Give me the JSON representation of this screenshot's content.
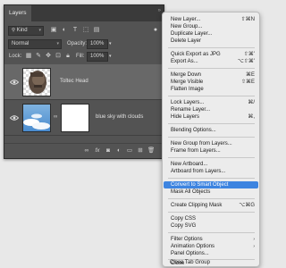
{
  "panel": {
    "tab_label": "Layers",
    "menu_glyph": "≡",
    "filter": {
      "value": "Kind",
      "icon": "search-icon"
    },
    "blend_mode": "Normal",
    "opacity_label": "Opacity:",
    "opacity_value": "100%",
    "lock_label": "Lock:",
    "fill_label": "Fill:",
    "fill_value": "100%",
    "layers": [
      {
        "name": "Toltec Head",
        "visible": true,
        "selected": true,
        "thumbnail": "stone-head"
      },
      {
        "name": "blue sky with clouds",
        "visible": true,
        "selected": false,
        "thumbnail": "sky-with-mask"
      }
    ],
    "footer_icons": [
      "link-icon",
      "fx-icon",
      "mask-icon",
      "adjustment-icon",
      "folder-icon",
      "new-layer-icon",
      "trash-icon"
    ],
    "footer_glyphs": {
      "link": "∞",
      "fx": "fx",
      "mask": "◙",
      "adjustment": "◐",
      "folder": "▭",
      "new_layer": "⊞",
      "trash": "🗑"
    }
  },
  "menu": {
    "items": [
      {
        "label": "New Layer...",
        "shortcut": "⇧⌘N"
      },
      {
        "label": "New Group...",
        "shortcut": ""
      },
      {
        "label": "Duplicate Layer...",
        "shortcut": ""
      },
      {
        "label": "Delete Layer",
        "shortcut": ""
      },
      {
        "label": "Quick Export as JPG",
        "shortcut": "⇧⌘'"
      },
      {
        "label": "Export As...",
        "shortcut": "⌥⇧⌘'"
      },
      {
        "label": "Merge Down",
        "shortcut": "⌘E"
      },
      {
        "label": "Merge Visible",
        "shortcut": "⇧⌘E"
      },
      {
        "label": "Flatten Image",
        "shortcut": ""
      },
      {
        "label": "Lock Layers...",
        "shortcut": "⌘/"
      },
      {
        "label": "Rename Layer...",
        "shortcut": ""
      },
      {
        "label": "Hide Layers",
        "shortcut": "⌘,"
      },
      {
        "label": "Blending Options...",
        "shortcut": ""
      },
      {
        "label": "New Group from Layers...",
        "shortcut": ""
      },
      {
        "label": "Frame from Layers...",
        "shortcut": ""
      },
      {
        "label": "New Artboard...",
        "shortcut": ""
      },
      {
        "label": "Artboard from Layers...",
        "shortcut": ""
      },
      {
        "label": "Convert to Smart Object",
        "shortcut": "",
        "highlighted": true
      },
      {
        "label": "Mask All Objects",
        "shortcut": ""
      },
      {
        "label": "Create Clipping Mask",
        "shortcut": "⌥⌘G"
      },
      {
        "label": "Copy CSS",
        "shortcut": ""
      },
      {
        "label": "Copy SVG",
        "shortcut": ""
      },
      {
        "label": "Filter Options",
        "shortcut": "",
        "submenu": true
      },
      {
        "label": "Animation Options",
        "shortcut": "",
        "submenu": true
      },
      {
        "label": "Panel Options...",
        "shortcut": ""
      },
      {
        "label": "Close",
        "shortcut": ""
      },
      {
        "label": "Close Tab Group",
        "shortcut": ""
      }
    ],
    "submenu_glyph": "›"
  },
  "colors": {
    "panel_bg": "#535353",
    "selected_row": "#686868",
    "menu_bg": "#ececec",
    "highlight": "#3d84e0"
  }
}
